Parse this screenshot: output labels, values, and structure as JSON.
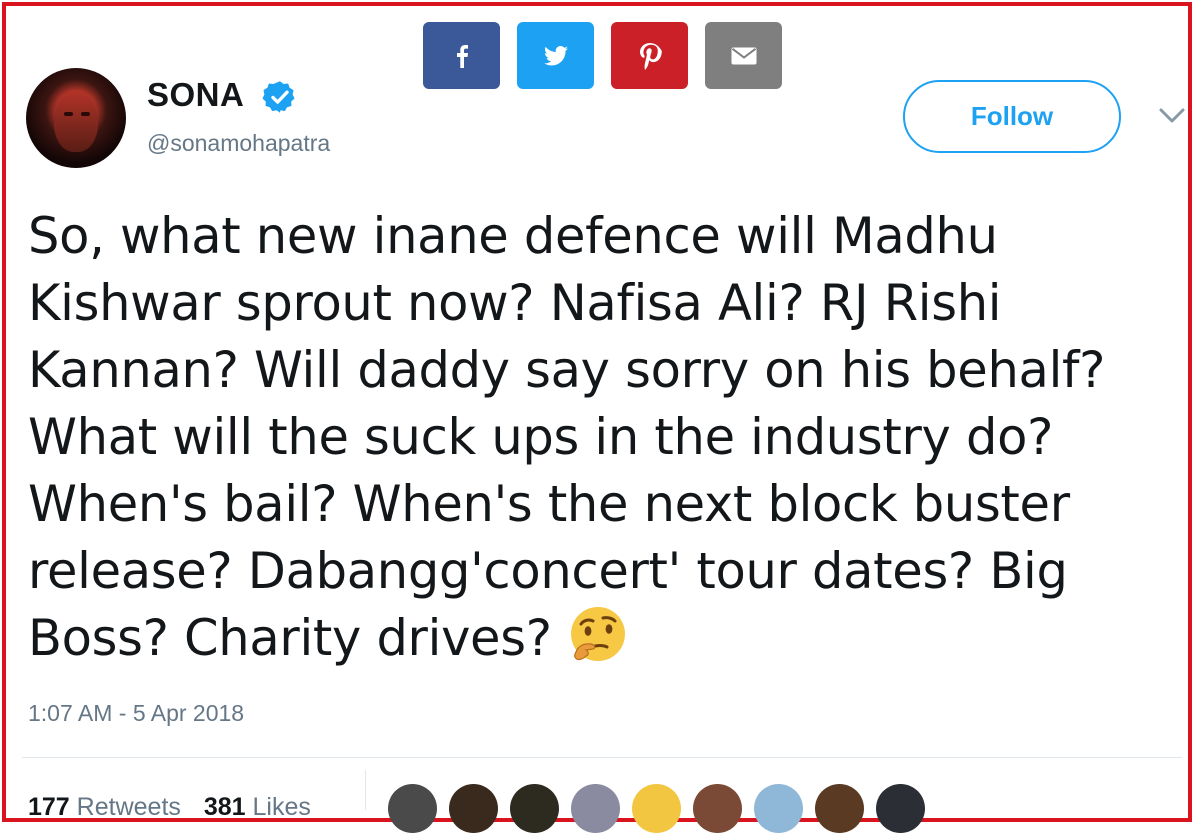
{
  "share": {
    "buttons": [
      {
        "name": "facebook",
        "color": "#3b5998"
      },
      {
        "name": "twitter",
        "color": "#1da1f2"
      },
      {
        "name": "pinterest",
        "color": "#cb2027"
      },
      {
        "name": "email",
        "color": "#7f7f7f"
      }
    ]
  },
  "tweet": {
    "author": {
      "display_name": "SONA",
      "handle": "@sonamohapatra",
      "verified": true
    },
    "follow_label": "Follow",
    "text_lines": [
      "So, what new inane defence will Madhu",
      "Kishwar sprout now? Nafisa Ali? RJ Rishi",
      "Kannan? Will daddy say sorry on his behalf?",
      "What will the suck ups in the industry do?",
      "When's bail? When's the next block buster",
      "release? Dabangg'concert' tour dates? Big",
      "Boss? Charity drives?"
    ],
    "emoji": "thinking-face",
    "timestamp": "1:07 AM - 5 Apr 2018",
    "stats": {
      "retweets_count": "177",
      "retweets_label": "Retweets",
      "likes_count": "381",
      "likes_label": "Likes"
    },
    "liker_colors": [
      "#4a4a4a",
      "#3a2a1e",
      "#2d2a20",
      "#8a8aa0",
      "#f2c640",
      "#7a4a36",
      "#8fb7d8",
      "#5a3a22",
      "#2b2e35"
    ]
  }
}
